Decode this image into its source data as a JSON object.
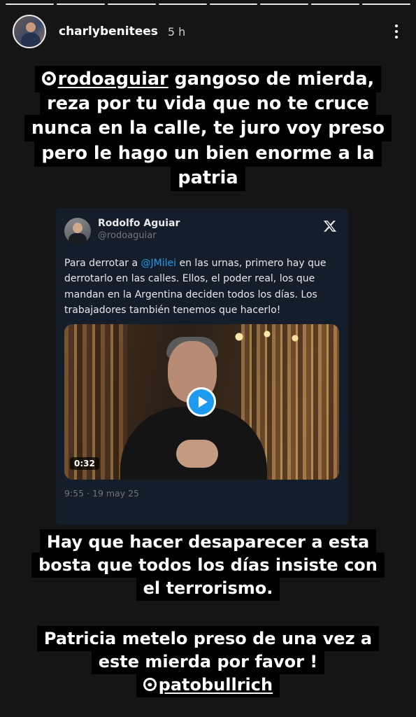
{
  "story": {
    "username": "charlybenitees",
    "time_ago": "5 h",
    "progress_segments": 8
  },
  "caption_top": {
    "mention": "rodoaguiar",
    "lines": [
      "gangoso de mierda,",
      "reza por tu vida que no te cruce",
      "nunca en la calle, te juro voy preso",
      "pero le hago un bien enorme a la",
      "patria"
    ]
  },
  "tweet": {
    "name": "Rodolfo Aguiar",
    "handle": "@rodoaguiar",
    "text_before": "Para derrotar a ",
    "text_link": "@JMilei",
    "text_after": " en las urnas, primero hay que derrotarlo en las calles. Ellos, el poder real, los que mandan en la Argentina deciden todos los días. Los trabajadores también tenemos que hacerlo!",
    "video_duration": "0:32",
    "timestamp": "9:55 · 19 may 25",
    "link_color": "#1d9bf0"
  },
  "caption_middle": {
    "lines": [
      "Hay que hacer desaparecer a esta",
      "bosta que todos los días insiste con",
      "el terrorismo."
    ]
  },
  "caption_bottom": {
    "lines": [
      "Patricia metelo preso de una vez a",
      "este mierda por favor !"
    ],
    "mention": "patobullrich"
  }
}
